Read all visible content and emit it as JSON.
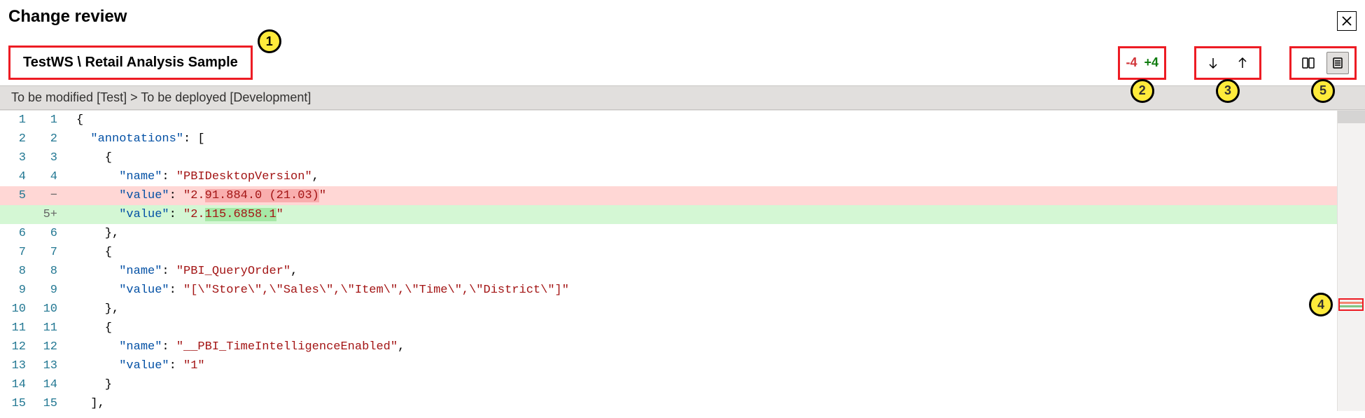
{
  "title": "Change review",
  "breadcrumb": "TestWS \\ Retail Analysis Sample",
  "diffstat": {
    "removed": "-4",
    "added": "+4"
  },
  "pathbar": "To be modified [Test] > To be deployed [Development]",
  "callouts": {
    "c1": "1",
    "c2": "2",
    "c3": "3",
    "c4": "4",
    "c5": "5"
  },
  "code": {
    "l1": "{",
    "l2a": "  \"annotations\"",
    "l2b": ": [",
    "l3": "    {",
    "l4a": "      \"name\"",
    "l4b": ": ",
    "l4c": "\"PBIDesktopVersion\"",
    "l4d": ",",
    "l5a": "      \"value\"",
    "l5b": ": ",
    "l5c": "\"2.",
    "l5d": "91.884.0 (21.03)",
    "l5e": "\"",
    "l5pa": "      \"value\"",
    "l5pb": ": ",
    "l5pc": "\"2.",
    "l5pd": "115.6858.1",
    "l5pe": "\"",
    "l6": "    },",
    "l7": "    {",
    "l8a": "      \"name\"",
    "l8b": ": ",
    "l8c": "\"PBI_QueryOrder\"",
    "l8d": ",",
    "l9a": "      \"value\"",
    "l9b": ": ",
    "l9c": "\"[\\\"Store\\\",\\\"Sales\\\",\\\"Item\\\",\\\"Time\\\",\\\"District\\\"]\"",
    "l10": "    },",
    "l11": "    {",
    "l12a": "      \"name\"",
    "l12b": ": ",
    "l12c": "\"__PBI_TimeIntelligenceEnabled\"",
    "l12d": ",",
    "l13a": "      \"value\"",
    "l13b": ": ",
    "l13c": "\"1\"",
    "l14": "    }",
    "l15": "  ],"
  },
  "gutter": {
    "r1": {
      "o": "1",
      "n": "1"
    },
    "r2": {
      "o": "2",
      "n": "2"
    },
    "r3": {
      "o": "3",
      "n": "3"
    },
    "r4": {
      "o": "4",
      "n": "4"
    },
    "r5": {
      "o": "5",
      "n": "−"
    },
    "r5p": {
      "o": "",
      "n": "5+"
    },
    "r6": {
      "o": "6",
      "n": "6"
    },
    "r7": {
      "o": "7",
      "n": "7"
    },
    "r8": {
      "o": "8",
      "n": "8"
    },
    "r9": {
      "o": "9",
      "n": "9"
    },
    "r10": {
      "o": "10",
      "n": "10"
    },
    "r11": {
      "o": "11",
      "n": "11"
    },
    "r12": {
      "o": "12",
      "n": "12"
    },
    "r13": {
      "o": "13",
      "n": "13"
    },
    "r14": {
      "o": "14",
      "n": "14"
    },
    "r15": {
      "o": "15",
      "n": "15"
    }
  }
}
